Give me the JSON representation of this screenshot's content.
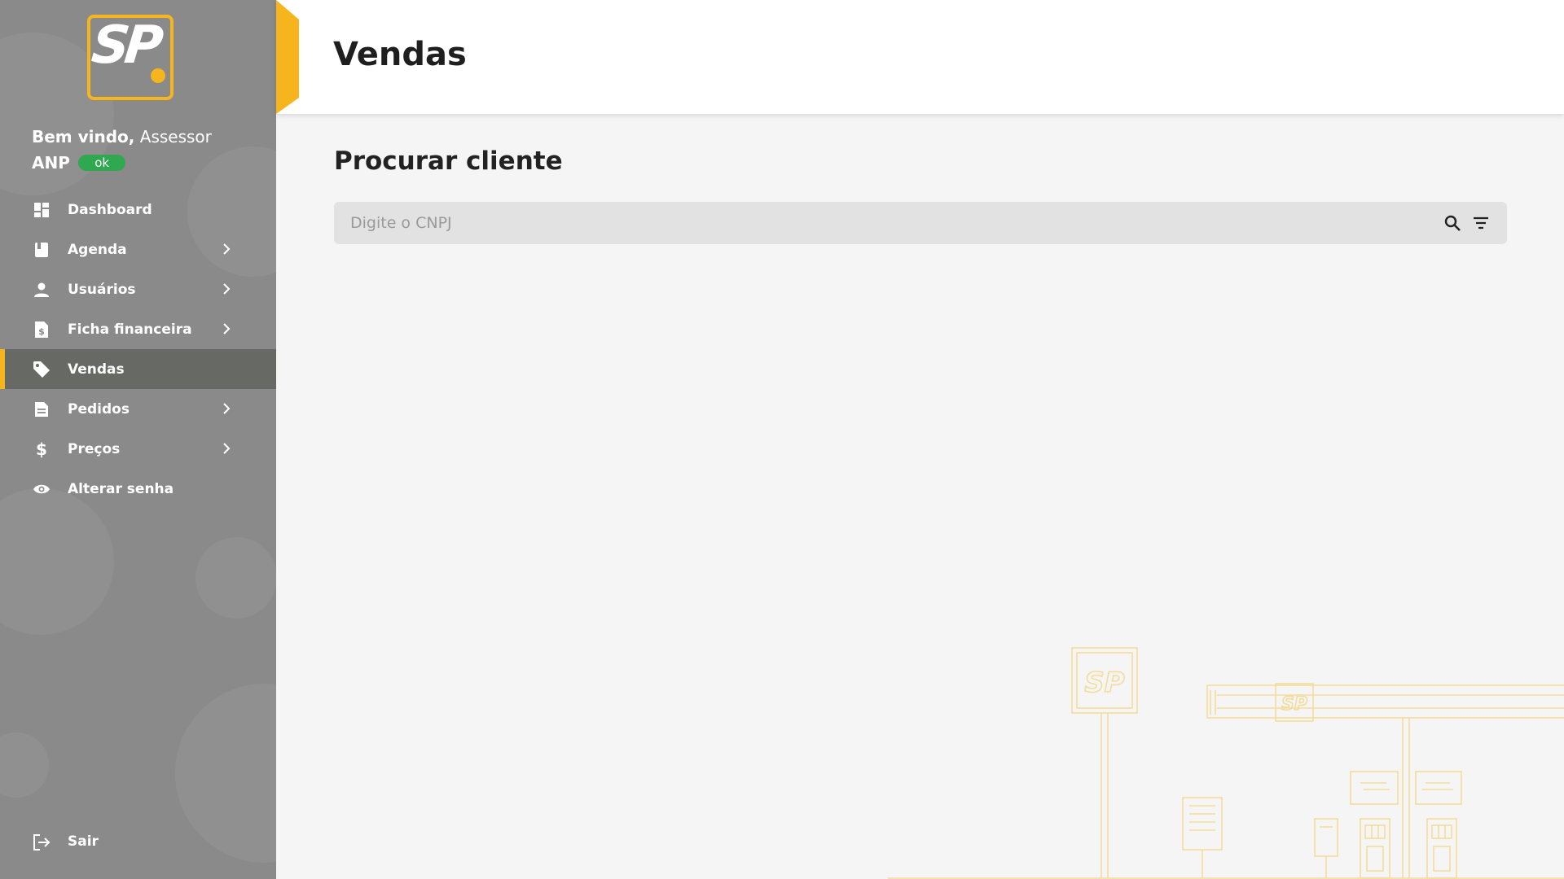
{
  "app": {
    "logo_text": "SP",
    "brand_color": "#f6b51c"
  },
  "sidebar": {
    "welcome_bold": "Bem vindo,",
    "welcome_role": "Assessor",
    "user_name": "ANP",
    "status_badge": "ok",
    "items": [
      {
        "label": "Dashboard",
        "icon": "dashboard-icon",
        "has_submenu": false,
        "active": false
      },
      {
        "label": "Agenda",
        "icon": "book-icon",
        "has_submenu": true,
        "active": false
      },
      {
        "label": "Usuários",
        "icon": "person-icon",
        "has_submenu": true,
        "active": false
      },
      {
        "label": "Ficha financeira",
        "icon": "invoice-icon",
        "has_submenu": true,
        "active": false
      },
      {
        "label": "Vendas",
        "icon": "tag-icon",
        "has_submenu": false,
        "active": true
      },
      {
        "label": "Pedidos",
        "icon": "document-icon",
        "has_submenu": true,
        "active": false
      },
      {
        "label": "Preços",
        "icon": "dollar-icon",
        "has_submenu": true,
        "active": false
      },
      {
        "label": "Alterar senha",
        "icon": "eye-icon",
        "has_submenu": false,
        "active": false
      }
    ],
    "logout_label": "Sair"
  },
  "header": {
    "title": "Vendas"
  },
  "main": {
    "section_title": "Procurar cliente",
    "search": {
      "placeholder": "Digite o CNPJ",
      "value": ""
    }
  }
}
